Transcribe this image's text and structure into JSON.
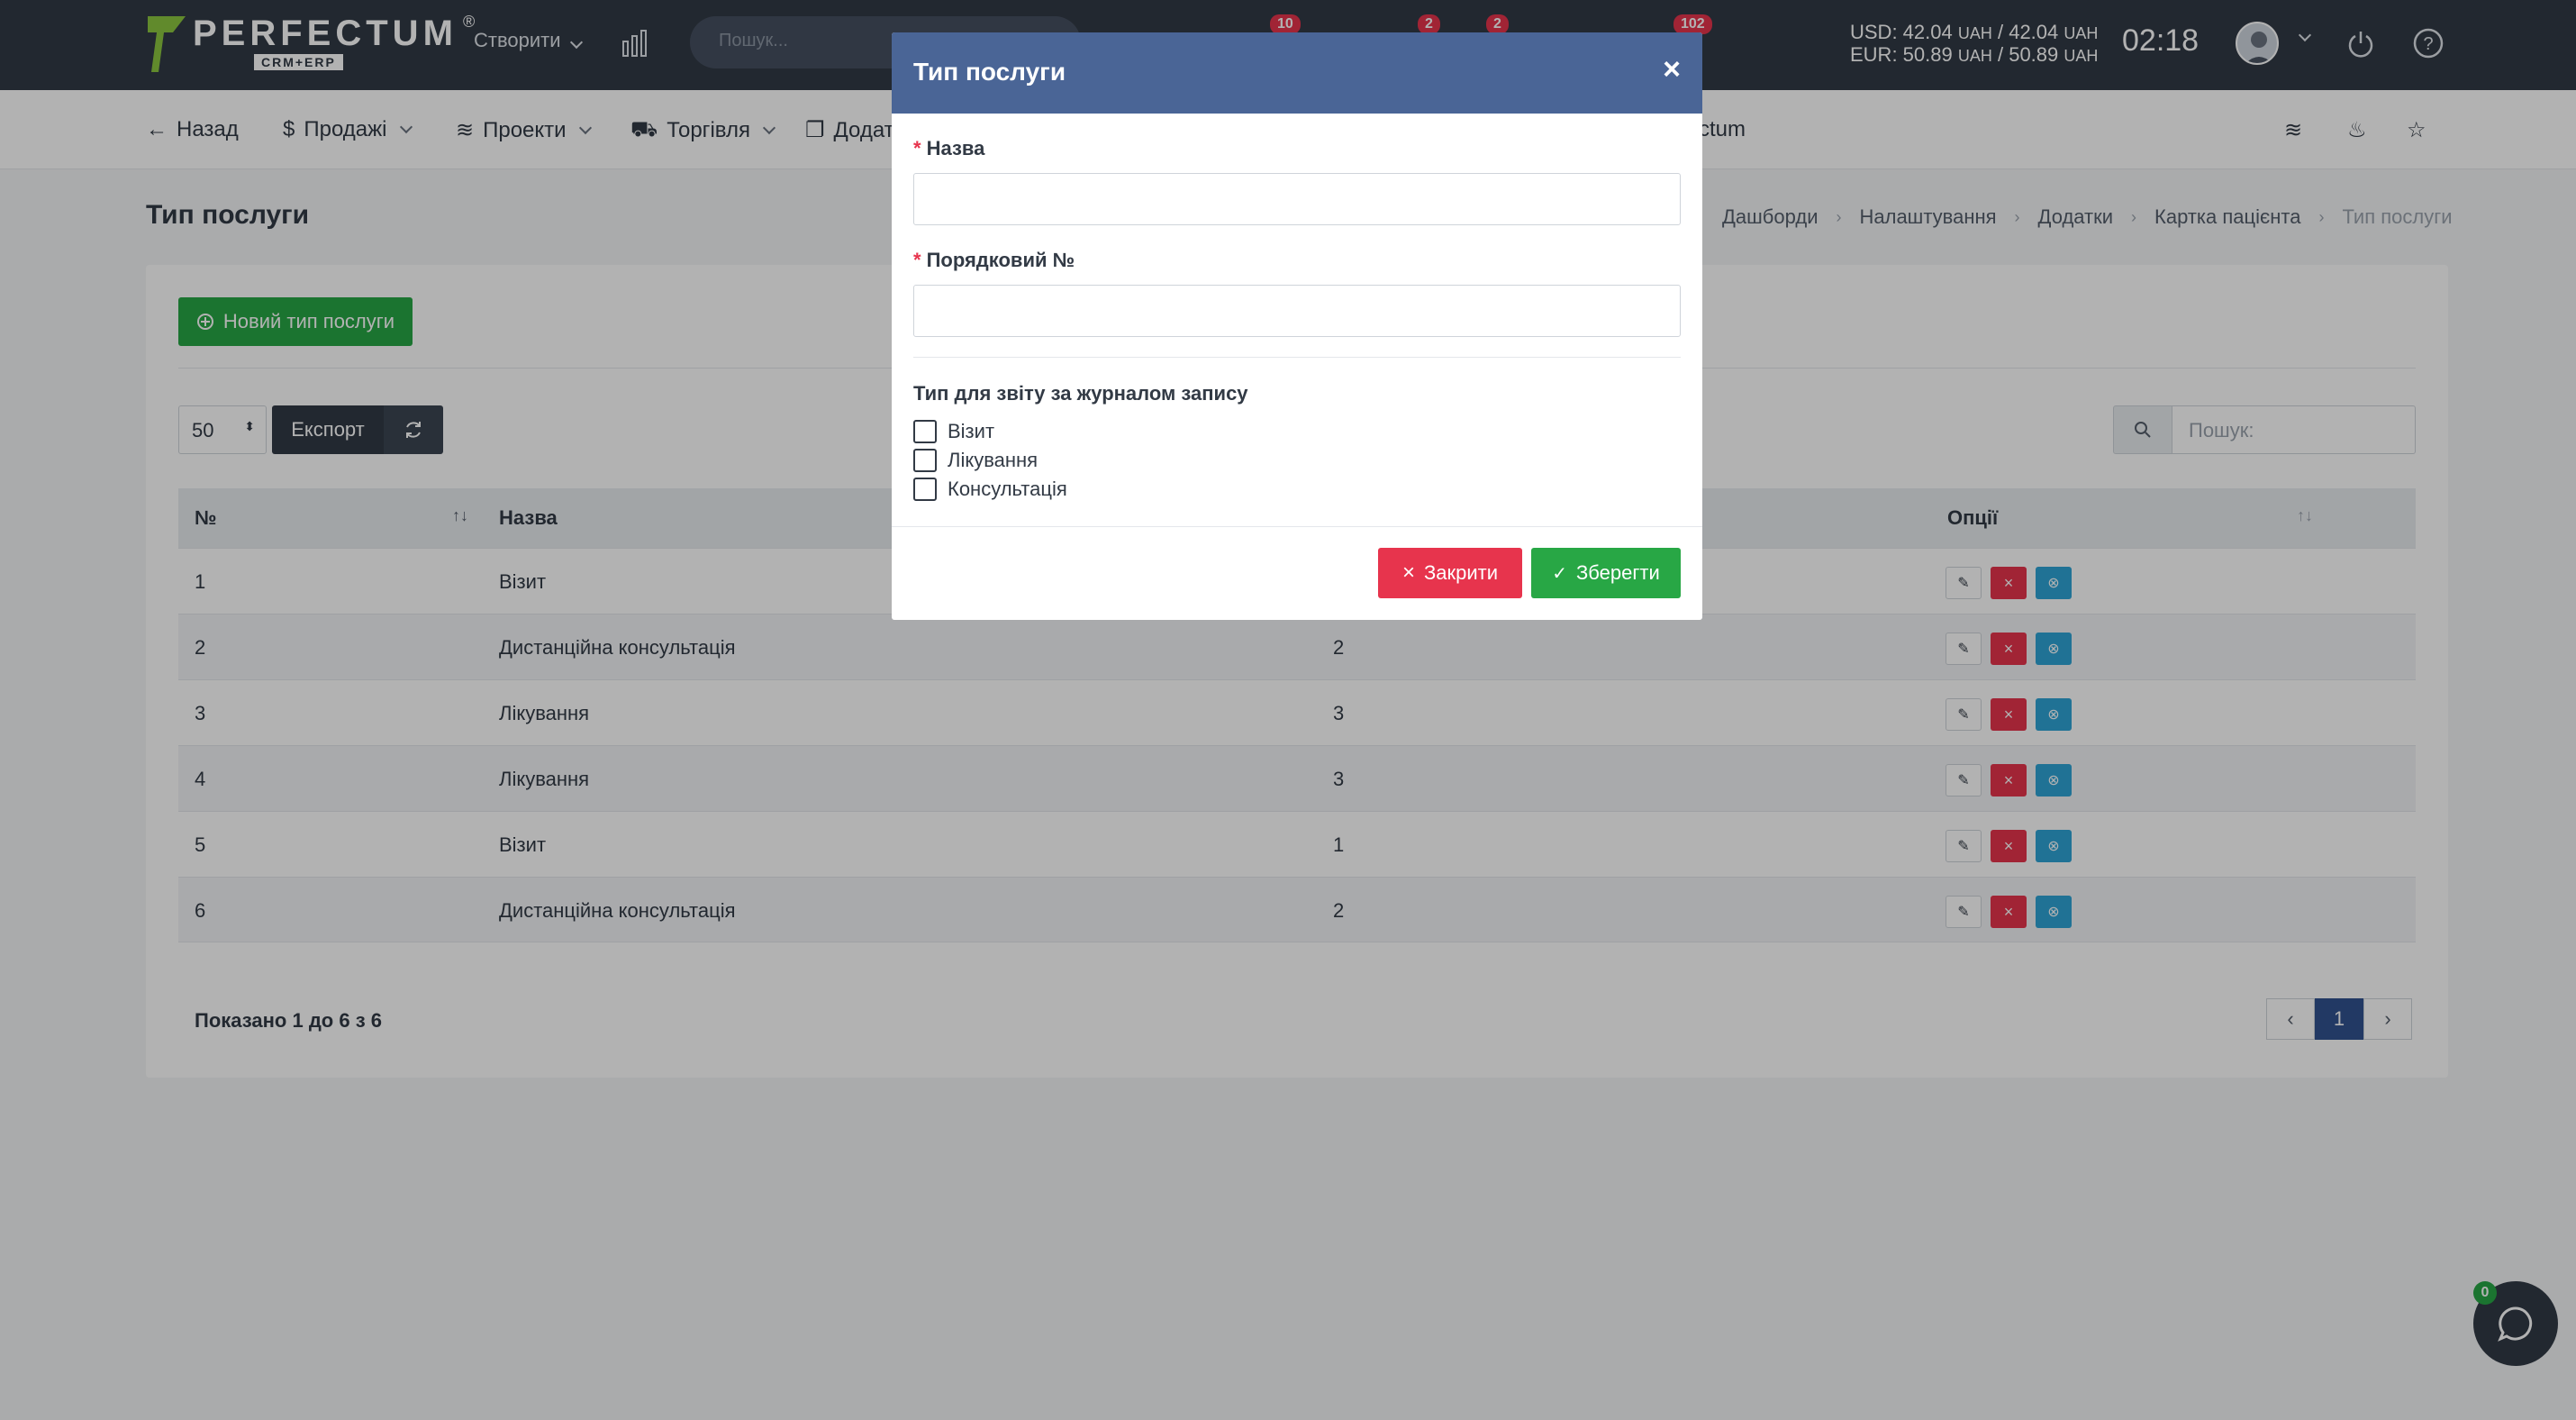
{
  "topbar": {
    "brand": "PERFECTUM",
    "brand_sub": "CRM+ERP",
    "reg_mark": "®",
    "create_label": "Створити",
    "search_placeholder": "Пошук...",
    "badges": [
      "10",
      "2",
      "2",
      "102"
    ],
    "rate_usd": "USD: 42.04",
    "rate_usd_mid": " / 42.04",
    "rate_eur": "EUR: 50.89",
    "rate_eur_mid": " / 50.89",
    "currency": "UAH",
    "clock": "02:18"
  },
  "subnav": {
    "back": "Назад",
    "sales": "Продажі",
    "projects": "Проекти",
    "trade": "Торгівля",
    "addons_partial": "Додат",
    "tail_partial": "ctum"
  },
  "page": {
    "title": "Тип послуги",
    "breadcrumb": [
      "Дашборди",
      "Налаштування",
      "Додатки",
      "Картка пацієнта",
      "Тип послуги"
    ]
  },
  "toolbar": {
    "new_button": "Новий тип послуги",
    "page_size": "50",
    "export": "Експорт",
    "search_placeholder": "Пошук:"
  },
  "table": {
    "headers": [
      "№",
      "Назва",
      "",
      "Опції"
    ],
    "rows": [
      {
        "num": "1",
        "name": "Візит",
        "order": ""
      },
      {
        "num": "2",
        "name": "Дистанційна консультація",
        "order": "2"
      },
      {
        "num": "3",
        "name": "Лікування",
        "order": "3"
      },
      {
        "num": "4",
        "name": "Лікування",
        "order": "3"
      },
      {
        "num": "5",
        "name": "Візит",
        "order": "1"
      },
      {
        "num": "6",
        "name": "Дистанційна консультація",
        "order": "2"
      }
    ],
    "showing": "Показано 1 до 6 з 6",
    "pages": [
      "‹",
      "1",
      "›"
    ]
  },
  "modal": {
    "title": "Тип послуги",
    "close_symbol": "×",
    "name_label": "Назва",
    "order_label": "Порядковий №",
    "required_mark": "*",
    "report_label": "Тип для звіту за журналом запису",
    "checkboxes": [
      "Візит",
      "Лікування",
      "Консультація"
    ],
    "close_button": "Закрити",
    "save_button": "Зберегти"
  },
  "chat": {
    "badge": "0"
  },
  "colors": {
    "topbar": "#323a45",
    "modal_header": "#4a6596",
    "green": "#28a745",
    "red": "#e7344d",
    "info": "#2fa4d6",
    "pager_active": "#325290"
  }
}
